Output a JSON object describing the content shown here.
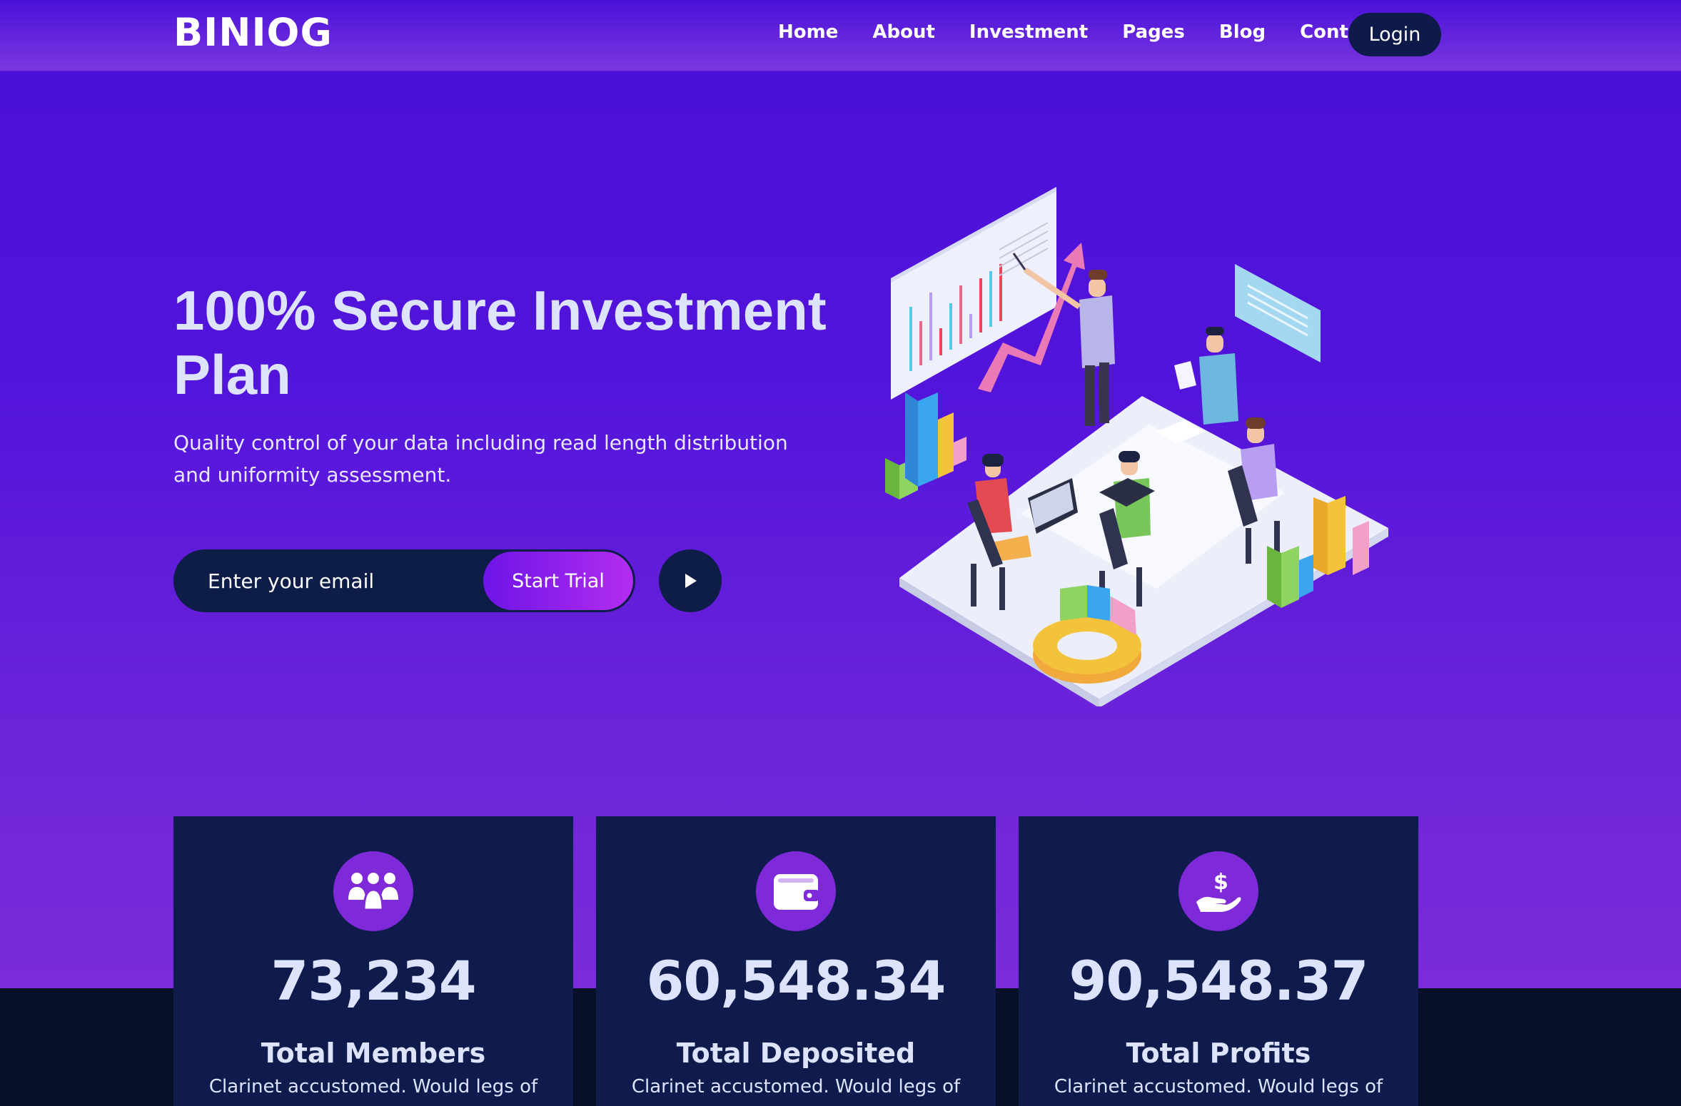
{
  "brand": {
    "logo": "BINIOG"
  },
  "nav": {
    "links": [
      "Home",
      "About",
      "Investment",
      "Pages",
      "Blog",
      "Contact"
    ],
    "login": "Login"
  },
  "hero": {
    "title": "100% Secure Investment Plan",
    "subtitle": "Quality control of your data including read length distribution and uniformity assessment.",
    "email_placeholder": "Enter your email",
    "cta": "Start Trial"
  },
  "stats": [
    {
      "icon": "users-group-icon",
      "value": "73,234",
      "label": "Total Members",
      "desc": "Clarinet accustomed. Would legs of"
    },
    {
      "icon": "wallet-icon",
      "value": "60,548.34",
      "label": "Total Deposited",
      "desc": "Clarinet accustomed. Would legs of"
    },
    {
      "icon": "hand-dollar-icon",
      "value": "90,548.37",
      "label": "Total Profits",
      "desc": "Clarinet accustomed. Would legs of"
    }
  ],
  "colors": {
    "hero_top": "#4a10d8",
    "hero_bottom": "#7a2cd8",
    "card": "#0e1b4c",
    "accent": "#7f2ad8"
  }
}
